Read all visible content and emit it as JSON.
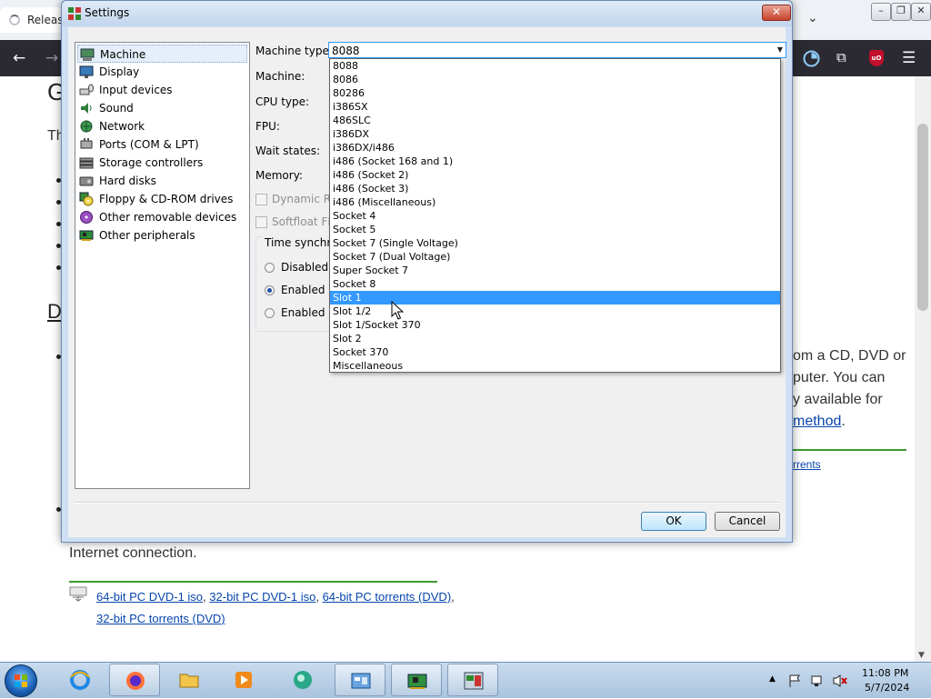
{
  "browser": {
    "tab_title": "Releas",
    "tab_dropdown": "⌄",
    "window_controls": [
      "–",
      "❐",
      "✕"
    ],
    "toolbar": {
      "back": "←",
      "forward": "→",
      "extensions": "⧉",
      "ublock": "uO",
      "menu": "☰"
    }
  },
  "page": {
    "heading_letter": "G",
    "para_start": "Th",
    "section_link": "D",
    "right_lines": [
      "om a CD, DVD or",
      "puter. You can",
      "y available for"
    ],
    "right_link": "method",
    "right_link_tail": ".",
    "torrents_link": "rrents",
    "internet_text": "Internet connection.",
    "download_links": {
      "l1": "64-bit PC DVD-1 iso",
      "l2": "32-bit PC DVD-1 iso",
      "l3": "64-bit PC torrents (DVD)",
      "l4": "32-bit PC torrents (DVD)",
      "sep": ", ",
      "end": ","
    }
  },
  "dialog": {
    "title": "Settings",
    "close_glyph": "✕",
    "nav_items": [
      {
        "label": "Machine"
      },
      {
        "label": "Display"
      },
      {
        "label": "Input devices"
      },
      {
        "label": "Sound"
      },
      {
        "label": "Network"
      },
      {
        "label": "Ports (COM & LPT)"
      },
      {
        "label": "Storage controllers"
      },
      {
        "label": "Hard disks"
      },
      {
        "label": "Floppy & CD-ROM drives"
      },
      {
        "label": "Other removable devices"
      },
      {
        "label": "Other peripherals"
      }
    ],
    "fields": {
      "machine_type_label": "Machine type:",
      "machine_type_value": "8088",
      "machine_label": "Machine:",
      "cpu_type_label": "CPU type:",
      "fpu_label": "FPU:",
      "wait_states_label": "Wait states:",
      "memory_label": "Memory:",
      "dynamic_label": "Dynamic Re",
      "softfloat_label": "Softfloat FPU",
      "time_sync_label": "Time synchro",
      "radio_disabled": "Disabled",
      "radio_enabled_1": "Enabled (l",
      "radio_enabled_2": "Enabled (U"
    },
    "dropdown_options": [
      "8088",
      "8086",
      "80286",
      "i386SX",
      "486SLC",
      "i386DX",
      "i386DX/i486",
      "i486 (Socket 168 and 1)",
      "i486 (Socket 2)",
      "i486 (Socket 3)",
      "i486 (Miscellaneous)",
      "Socket 4",
      "Socket 5",
      "Socket 7 (Single Voltage)",
      "Socket 7 (Dual Voltage)",
      "Super Socket 7",
      "Socket 8",
      "Slot 1",
      "Slot 1/2",
      "Slot 1/Socket 370",
      "Slot 2",
      "Socket 370",
      "Miscellaneous"
    ],
    "highlighted_option": "Slot 1",
    "ok_label": "OK",
    "cancel_label": "Cancel"
  },
  "taskbar": {
    "time": "11:08 PM",
    "date": "5/7/2024",
    "tray_arrow": "▲",
    "apps": [
      "internet-explorer",
      "firefox",
      "file-explorer",
      "media-player",
      "circle-app",
      "control-panel",
      "86box-machine",
      "86box-settings"
    ]
  },
  "colors": {
    "highlight": "#3399ff",
    "link": "#0645ad",
    "green_rule": "#3c9a2f",
    "browser_toolbar": "#2b2a33"
  }
}
